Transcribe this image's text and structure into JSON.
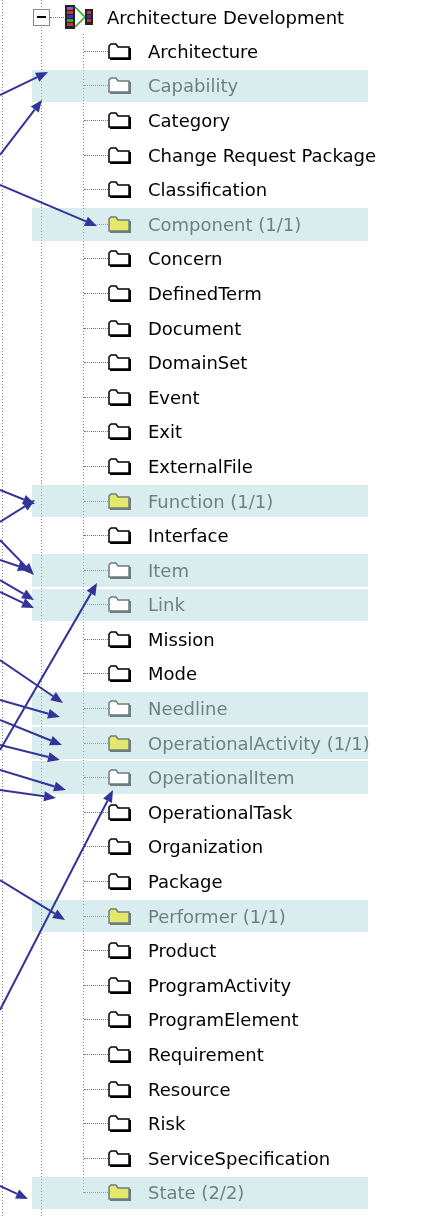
{
  "tree": {
    "label": "Architecture Development",
    "expanded": true,
    "children": [
      {
        "label": "Architecture",
        "highlighted": false,
        "filled": false
      },
      {
        "label": "Capability",
        "highlighted": true,
        "filled": false
      },
      {
        "label": "Category",
        "highlighted": false,
        "filled": false
      },
      {
        "label": "Change Request Package",
        "highlighted": false,
        "filled": false
      },
      {
        "label": "Classification",
        "highlighted": false,
        "filled": false
      },
      {
        "label": "Component (1/1)",
        "highlighted": true,
        "filled": true
      },
      {
        "label": "Concern",
        "highlighted": false,
        "filled": false
      },
      {
        "label": "DefinedTerm",
        "highlighted": false,
        "filled": false
      },
      {
        "label": "Document",
        "highlighted": false,
        "filled": false
      },
      {
        "label": "DomainSet",
        "highlighted": false,
        "filled": false
      },
      {
        "label": "Event",
        "highlighted": false,
        "filled": false
      },
      {
        "label": "Exit",
        "highlighted": false,
        "filled": false
      },
      {
        "label": "ExternalFile",
        "highlighted": false,
        "filled": false
      },
      {
        "label": "Function (1/1)",
        "highlighted": true,
        "filled": true
      },
      {
        "label": "Interface",
        "highlighted": false,
        "filled": false
      },
      {
        "label": "Item",
        "highlighted": true,
        "filled": false
      },
      {
        "label": "Link",
        "highlighted": true,
        "filled": false
      },
      {
        "label": "Mission",
        "highlighted": false,
        "filled": false
      },
      {
        "label": "Mode",
        "highlighted": false,
        "filled": false
      },
      {
        "label": "Needline",
        "highlighted": true,
        "filled": false
      },
      {
        "label": "OperationalActivity (1/1)",
        "highlighted": true,
        "filled": true
      },
      {
        "label": "OperationalItem",
        "highlighted": true,
        "filled": false
      },
      {
        "label": "OperationalTask",
        "highlighted": false,
        "filled": false
      },
      {
        "label": "Organization",
        "highlighted": false,
        "filled": false
      },
      {
        "label": "Package",
        "highlighted": false,
        "filled": false
      },
      {
        "label": "Performer (1/1)",
        "highlighted": true,
        "filled": true
      },
      {
        "label": "Product",
        "highlighted": false,
        "filled": false
      },
      {
        "label": "ProgramActivity",
        "highlighted": false,
        "filled": false
      },
      {
        "label": "ProgramElement",
        "highlighted": false,
        "filled": false
      },
      {
        "label": "Requirement",
        "highlighted": false,
        "filled": false
      },
      {
        "label": "Resource",
        "highlighted": false,
        "filled": false
      },
      {
        "label": "Risk",
        "highlighted": false,
        "filled": false
      },
      {
        "label": "ServiceSpecification",
        "highlighted": false,
        "filled": false
      },
      {
        "label": "State (2/2)",
        "highlighted": true,
        "filled": true
      }
    ]
  }
}
